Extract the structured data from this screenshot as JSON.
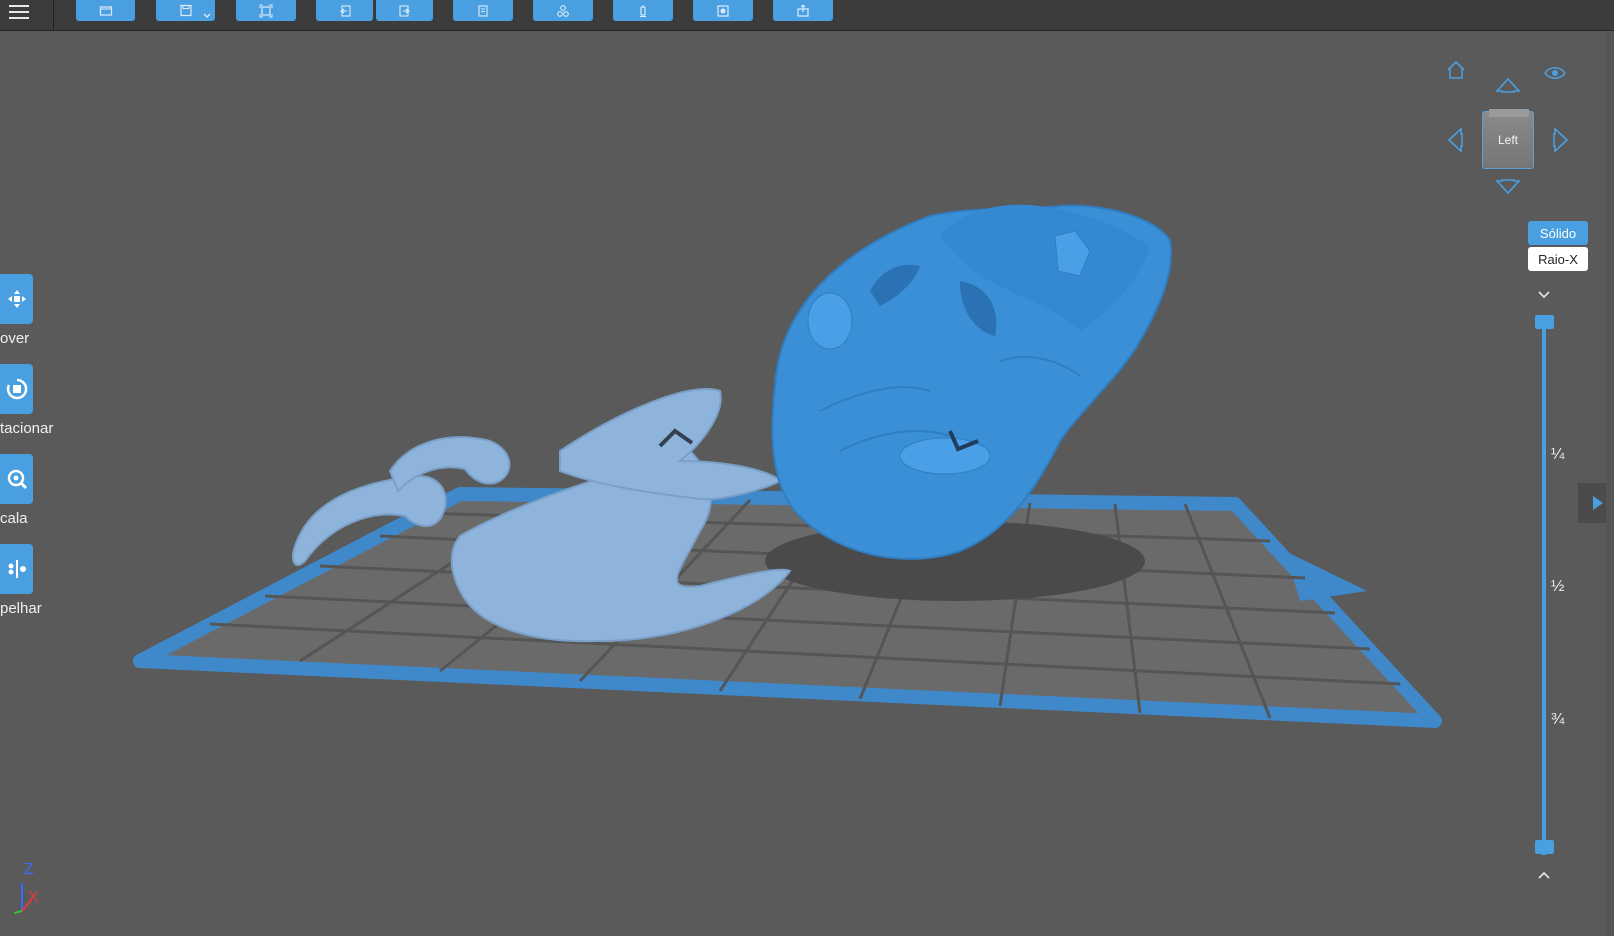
{
  "toolbar": {
    "tools": [
      {
        "id": "open",
        "icon": "folder-icon"
      },
      {
        "id": "save",
        "icon": "save-icon",
        "has_dropdown": true
      },
      {
        "id": "fit",
        "icon": "frame-icon"
      },
      {
        "id": "undo",
        "icon": "undo-icon"
      },
      {
        "id": "redo",
        "icon": "redo-icon"
      },
      {
        "id": "copy",
        "icon": "copy-icon"
      },
      {
        "id": "arrange",
        "icon": "arrange-icon"
      },
      {
        "id": "support",
        "icon": "support-icon"
      },
      {
        "id": "hollow",
        "icon": "hollow-icon"
      },
      {
        "id": "export",
        "icon": "export-icon"
      }
    ]
  },
  "side_tools": [
    {
      "label": "over",
      "icon": "move-icon"
    },
    {
      "label": "tacionar",
      "icon": "rotate-icon"
    },
    {
      "label": "cala",
      "icon": "scale-icon"
    },
    {
      "label": "pelhar",
      "icon": "mirror-icon"
    }
  ],
  "view": {
    "cube_label": "Left",
    "modes": {
      "solid": "Sólido",
      "xray": "Raio-X"
    },
    "active_mode": "solid"
  },
  "slider": {
    "fractions": [
      "¼",
      "½",
      "¾"
    ]
  },
  "axis": {
    "z": "Z",
    "x": "X"
  },
  "colors": {
    "accent": "#4a9fe0",
    "background": "#5a5a5a",
    "toolbar": "#3c3c3c",
    "model_primary": "#3a8fd6",
    "model_secondary": "#8fb4dc"
  }
}
